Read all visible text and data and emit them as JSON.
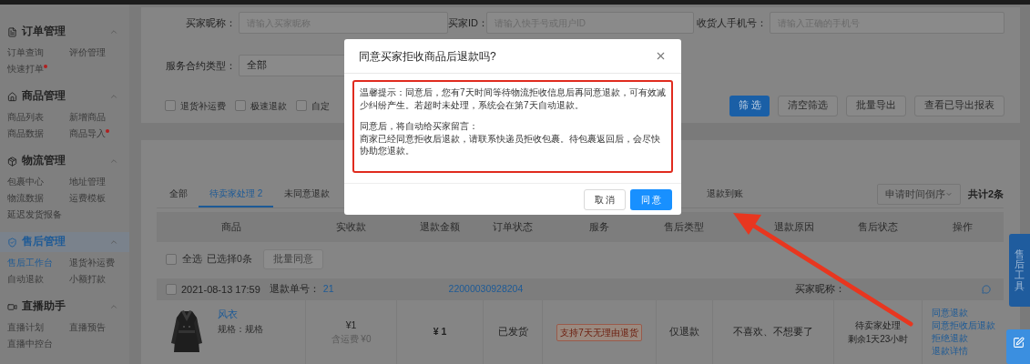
{
  "sidebar": {
    "sections": [
      {
        "title": "订单管理",
        "expanded": true,
        "selected": false,
        "items": [
          {
            "label": "订单查询",
            "selected": false,
            "dot": false
          },
          {
            "label": "评价管理",
            "selected": false,
            "dot": false
          },
          {
            "label": "快速打单",
            "selected": false,
            "dot": true
          }
        ]
      },
      {
        "title": "商品管理",
        "expanded": true,
        "selected": false,
        "items": [
          {
            "label": "商品列表",
            "selected": false,
            "dot": false
          },
          {
            "label": "新增商品",
            "selected": false,
            "dot": false
          },
          {
            "label": "商品数据",
            "selected": false,
            "dot": false
          },
          {
            "label": "商品导入",
            "selected": false,
            "dot": true
          }
        ]
      },
      {
        "title": "物流管理",
        "expanded": true,
        "selected": false,
        "items": [
          {
            "label": "包裹中心",
            "selected": false,
            "dot": false
          },
          {
            "label": "地址管理",
            "selected": false,
            "dot": false
          },
          {
            "label": "物流数据",
            "selected": false,
            "dot": false
          },
          {
            "label": "运费模板",
            "selected": false,
            "dot": false
          },
          {
            "label": "延迟发货报备",
            "selected": false,
            "dot": false
          }
        ]
      },
      {
        "title": "售后管理",
        "expanded": true,
        "selected": true,
        "items": [
          {
            "label": "售后工作台",
            "selected": true,
            "dot": false
          },
          {
            "label": "退货补运费",
            "selected": false,
            "dot": false
          },
          {
            "label": "自动退款",
            "selected": false,
            "dot": false
          },
          {
            "label": "小额打款",
            "selected": false,
            "dot": false
          }
        ]
      },
      {
        "title": "直播助手",
        "expanded": true,
        "selected": false,
        "items": [
          {
            "label": "直播计划",
            "selected": false,
            "dot": false
          },
          {
            "label": "直播预告",
            "selected": false,
            "dot": false
          },
          {
            "label": "直播中控台",
            "selected": false,
            "dot": false
          }
        ]
      }
    ]
  },
  "filters": {
    "fields": [
      {
        "label": "买家昵称：",
        "placeholder": "请输入买家昵称"
      },
      {
        "label": "买家ID：",
        "placeholder": "请输入快手号或用户ID"
      },
      {
        "label": "收货人手机号：",
        "placeholder": "请输入正确的手机号"
      }
    ],
    "service_type": {
      "label": "服务合约类型：",
      "value": "全部"
    },
    "checkboxes": [
      {
        "label": "退货补运费",
        "checked": false
      },
      {
        "label": "极速退款",
        "checked": false
      },
      {
        "label": "自定",
        "checked": false
      }
    ],
    "buttons": [
      {
        "label": "筛 选",
        "kind": "primary"
      },
      {
        "label": "清空筛选",
        "kind": "default"
      },
      {
        "label": "批量导出",
        "kind": "default"
      },
      {
        "label": "查看已导出报表",
        "kind": "default"
      }
    ]
  },
  "tabs": [
    {
      "label": "全部",
      "selected": false
    },
    {
      "label": "待卖家处理 2",
      "selected": true
    },
    {
      "label": "未同意退款",
      "selected": false
    },
    {
      "label": "退款到账",
      "selected": false
    }
  ],
  "sort": {
    "value": "申请时间倒序"
  },
  "total": "共计2条",
  "columns": [
    "商品",
    "实收款",
    "退款金额",
    "订单状态",
    "服务",
    "售后类型",
    "退款原因",
    "售后状态",
    "操作"
  ],
  "select_all": {
    "label": "全选",
    "checked": false,
    "count": "已选择0条",
    "button": {
      "label": "批量同意",
      "disabled": true
    }
  },
  "order": {
    "checked": false,
    "date": "2021-08-13 17:59",
    "refund_no_label": "退款单号：",
    "refund_no_start": "21",
    "refund_no_end": "22000030928204",
    "buyer_label": "买家昵称：",
    "product": {
      "name": "风衣",
      "spec": "规格：规格"
    },
    "paid": "¥1",
    "shipping": "含运费 ¥0",
    "refund": "¥ 1",
    "status": "已发货",
    "service": "支持7天无理由退货",
    "type": "仅退款",
    "reason": "不喜欢、不想要了",
    "after_sale_status": [
      "待卖家处理",
      "剩余1天23小时"
    ],
    "actions": [
      "同意退款",
      "同意拒收后退款",
      "拒绝退款",
      "退款详情"
    ]
  },
  "side_tool": {
    "label": "售后工具"
  },
  "modal": {
    "title": "同意买家拒收商品后退款吗?",
    "notice": "温馨提示：同意后，您有7天时间等待物流拒收信息后再同意退款，可有效减少纠纷产生。若超时未处理，系统会在第7天自动退款。",
    "message_heading": "同意后，将自动给买家留言：",
    "message": "商家已经同意拒收后退款，请联系快递员拒收包裹。待包裹返回后，会尽快协助您退款。",
    "buttons": [
      {
        "label": "取 消",
        "kind": "default"
      },
      {
        "label": "同 意",
        "kind": "primary"
      }
    ]
  }
}
